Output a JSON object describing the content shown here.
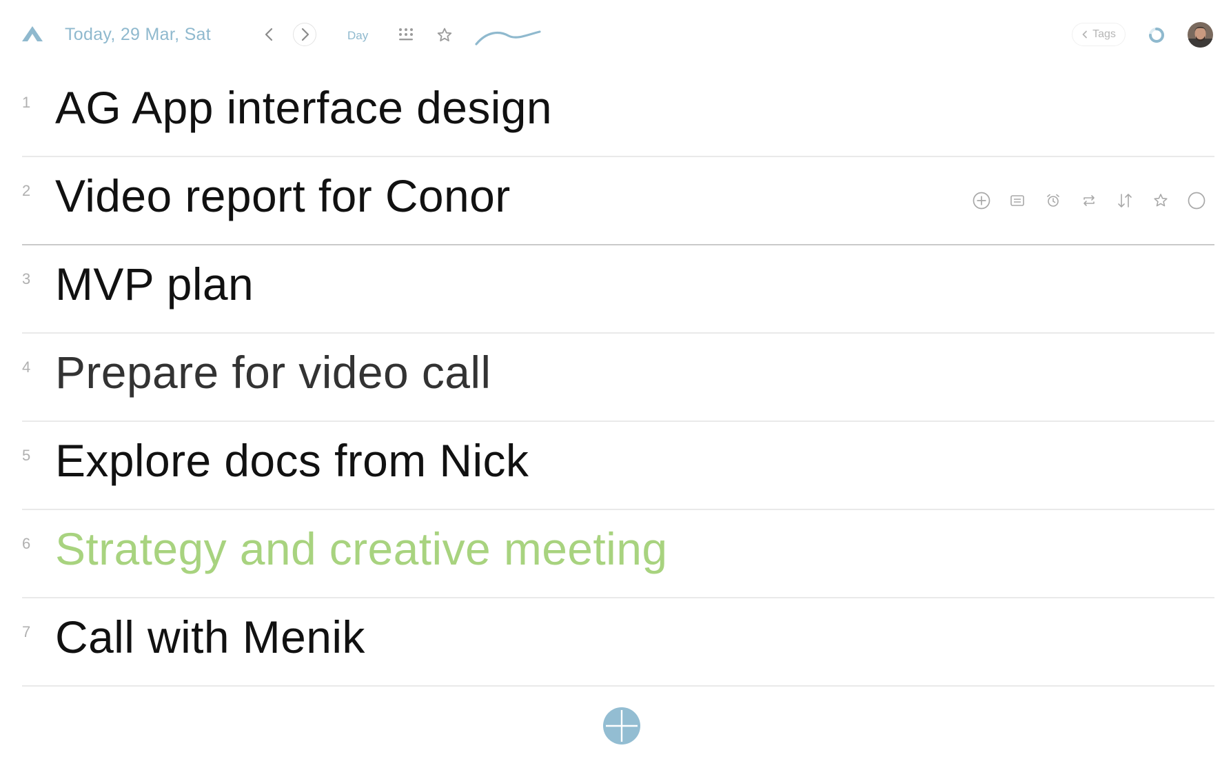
{
  "header": {
    "date_label": "Today, 29 Mar, Sat",
    "view_label": "Day",
    "tags_label": "Tags",
    "icons": [
      "app-logo-icon",
      "chevron-left-icon",
      "chevron-right-icon",
      "grid-dots-icon",
      "star-icon",
      "wave-icon",
      "progress-ring-icon",
      "avatar"
    ]
  },
  "tasks": [
    {
      "number": "1",
      "title": "AG App interface design",
      "color": "#111111"
    },
    {
      "number": "2",
      "title": "Video report for Conor",
      "color": "#111111"
    },
    {
      "number": "3",
      "title": "MVP plan",
      "color": "#111111"
    },
    {
      "number": "4",
      "title": "Prepare for video call",
      "color": "#333333"
    },
    {
      "number": "5",
      "title": "Explore docs from Nick",
      "color": "#111111"
    },
    {
      "number": "6",
      "title": "Strategy and creative meeting",
      "color": "#a8d37f"
    },
    {
      "number": "7",
      "title": "Call with Menik",
      "color": "#111111"
    }
  ],
  "row_actions": [
    "add-subtask-icon",
    "note-icon",
    "alarm-icon",
    "repeat-icon",
    "sort-icon",
    "star-icon",
    "complete-circle-icon"
  ],
  "colors": {
    "accent": "#8fb9ce",
    "add_button": "#93bdd2",
    "highlight_task": "#a8d37f"
  }
}
